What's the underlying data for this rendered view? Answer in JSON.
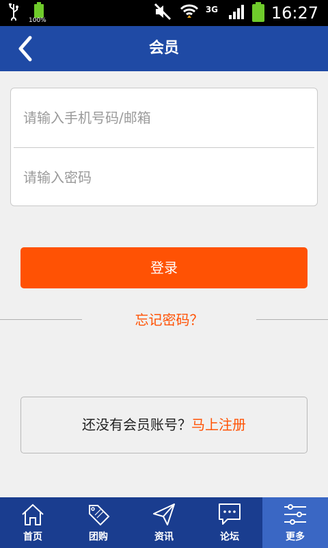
{
  "status_bar": {
    "battery_small_pct": "100%",
    "network": "3G",
    "time": "16:27"
  },
  "header": {
    "title": "会员"
  },
  "form": {
    "phone_placeholder": "请输入手机号码/邮箱",
    "password_placeholder": "请输入密码"
  },
  "login_label": "登录",
  "forgot_label": "忘记密码？",
  "register": {
    "prompt": "还没有会员账号？",
    "link": "马上注册"
  },
  "nav": [
    {
      "label": "首页",
      "icon": "home-icon"
    },
    {
      "label": "团购",
      "icon": "sale-tag-icon"
    },
    {
      "label": "资讯",
      "icon": "paper-plane-icon"
    },
    {
      "label": "论坛",
      "icon": "chat-bubble-icon"
    },
    {
      "label": "更多",
      "icon": "settings-sliders-icon",
      "active": true
    }
  ],
  "colors": {
    "header": "#1f4aa5",
    "accent": "#ff5204",
    "nav": "#1a3d8f",
    "nav_active": "#3a67c4"
  }
}
